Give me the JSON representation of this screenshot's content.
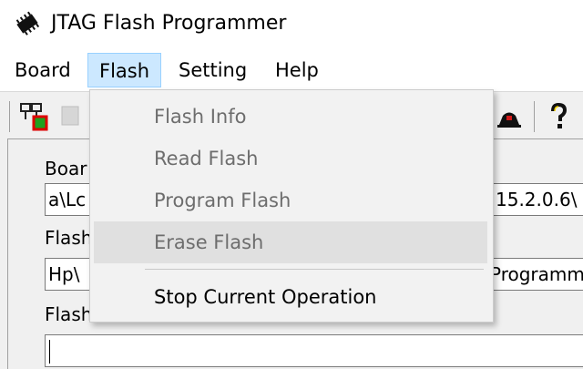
{
  "window": {
    "title": "JTAG Flash Programmer",
    "icon": "chip-icon"
  },
  "menubar": {
    "items": [
      {
        "label": "Board"
      },
      {
        "label": "Flash",
        "active": true
      },
      {
        "label": "Setting"
      },
      {
        "label": "Help"
      }
    ]
  },
  "toolbar": {
    "buttons": [
      {
        "icon": "connect-board-icon"
      },
      {
        "icon": "flash-chip-icon"
      },
      {
        "icon": "stop-icon"
      },
      {
        "icon": "help-question-icon"
      }
    ]
  },
  "form": {
    "board_label": "Boar",
    "board_value": "a\\Lc",
    "board_value_right": "15.2.0.6\\",
    "flash_label": "Flash",
    "flash_value": "Hp\\",
    "flash_value_right": "Programme",
    "flash_image_label": "Flash"
  },
  "flash_menu": {
    "items": [
      {
        "label": "Flash Info",
        "enabled": false
      },
      {
        "label": "Read Flash",
        "enabled": false
      },
      {
        "label": "Program Flash",
        "enabled": false
      },
      {
        "label": "Erase Flash",
        "enabled": false,
        "hovered": true
      },
      {
        "label": "Stop Current Operation",
        "enabled": true
      }
    ]
  },
  "colors": {
    "menu_active_bg": "#cce8ff",
    "menu_active_border": "#99d1ff",
    "disabled_text": "#6d6d6d"
  }
}
